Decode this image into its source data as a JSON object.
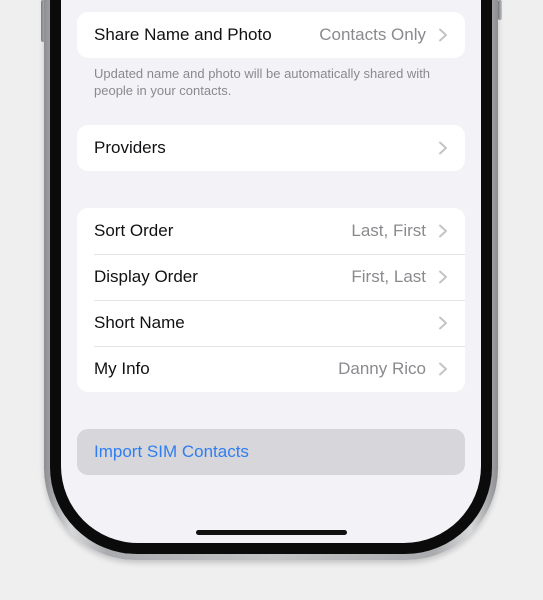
{
  "settings": {
    "share_group": {
      "label": "Share Name and Photo",
      "value": "Contacts Only",
      "footnote": "Updated name and photo will be automatically shared with people in your contacts."
    },
    "providers": {
      "label": "Providers"
    },
    "contacts_group": {
      "rows": [
        {
          "label": "Sort Order",
          "value": "Last, First"
        },
        {
          "label": "Display Order",
          "value": "First, Last"
        },
        {
          "label": "Short Name",
          "value": ""
        },
        {
          "label": "My Info",
          "value": "Danny Rico"
        }
      ]
    },
    "import": {
      "label": "Import SIM Contacts"
    }
  },
  "icons": {
    "chevron": "chevron-right-icon"
  },
  "colors": {
    "background": "#f2f2f7",
    "link": "#2f7ef0",
    "secondary_text": "#8a8a8e",
    "pressed_row": "#d6d6db"
  }
}
